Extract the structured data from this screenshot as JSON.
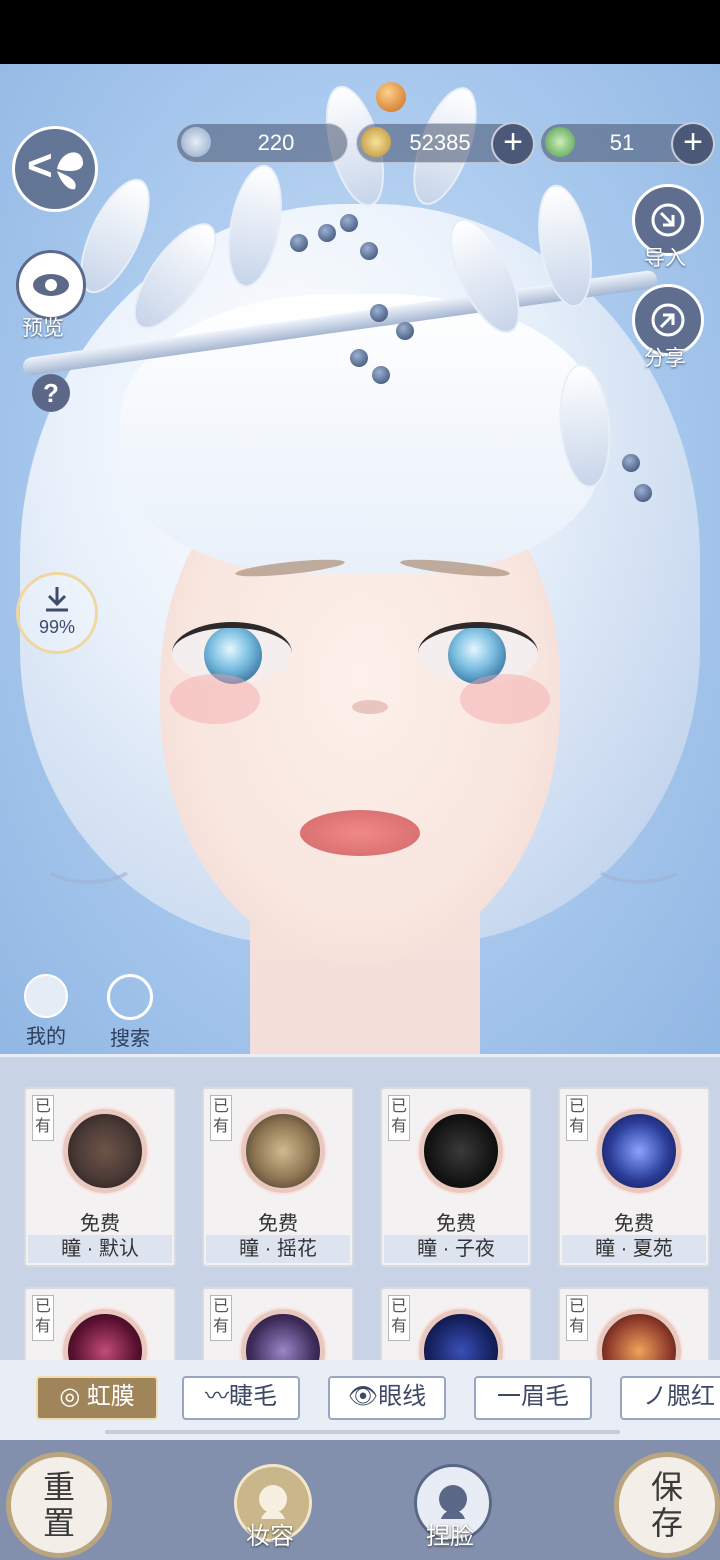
{
  "topbar": {
    "currencies": [
      {
        "name": "jade",
        "value": "220",
        "icon": "jade-currency-icon"
      },
      {
        "name": "coin",
        "value": "52385",
        "icon": "coin-currency-icon"
      },
      {
        "name": "token",
        "value": "51",
        "icon": "token-currency-icon"
      }
    ],
    "add_glyph": "+"
  },
  "left_tools": {
    "back_glyph": "<",
    "preview_label": "预览",
    "help_glyph": "?",
    "download_percent": "99%",
    "mine_label": "我的",
    "search_label": "搜索"
  },
  "right_tools": {
    "import_label": "导入",
    "share_label": "分享"
  },
  "items": [
    {
      "owned": "已有",
      "price": "免费",
      "name": "瞳 · 默认",
      "color": "#4a3a36"
    },
    {
      "owned": "已有",
      "price": "免费",
      "name": "瞳 · 摇花",
      "color": "#8c7452"
    },
    {
      "owned": "已有",
      "price": "免费",
      "name": "瞳 · 子夜",
      "color": "#141414"
    },
    {
      "owned": "已有",
      "price": "免费",
      "name": "瞳 · 夏苑",
      "color": "#2c3d9a"
    },
    {
      "owned": "已有",
      "price": "",
      "name": "",
      "color": "#5a1130"
    },
    {
      "owned": "已有",
      "price": "",
      "name": "",
      "color": "#3f2d5c"
    },
    {
      "owned": "已有",
      "price": "",
      "name": "",
      "color": "#15215e"
    },
    {
      "owned": "已有",
      "price": "",
      "name": "",
      "color": "#8d3a2a"
    }
  ],
  "tabs": [
    {
      "label": "◎ 虹膜",
      "active": true
    },
    {
      "label": "〰睫毛",
      "active": false
    },
    {
      "label": "👁眼线",
      "active": false
    },
    {
      "label": "一眉毛",
      "active": false
    },
    {
      "label": "ノ腮红",
      "active": false
    }
  ],
  "bottom": {
    "reset_label": "重置",
    "makeup_label": "妆容",
    "face_label": "捏脸",
    "save_label": "保存"
  },
  "colors": {
    "panel_bg": "#c9d3e6",
    "active_tab": "#a0855a",
    "bottom_bar": "#8390ad"
  }
}
